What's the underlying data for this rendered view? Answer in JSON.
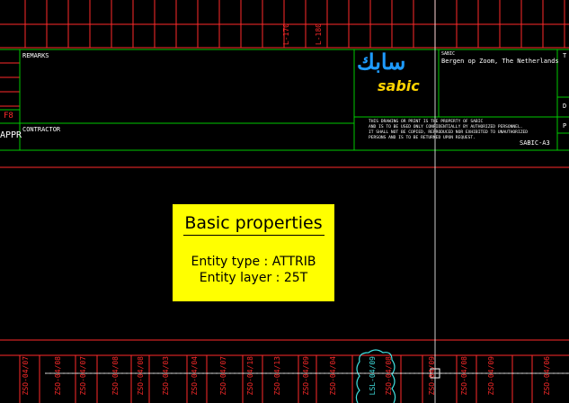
{
  "titleblock": {
    "remarks_label": "REMARKS",
    "contractor_label": "CONTRACTOR",
    "f8_label": "F8",
    "appr_label": "APPR",
    "company_code": "SABIC",
    "company_location": "Bergen op Zoom, The Netherlands",
    "logo_arabic": "سابك",
    "logo_latin": "sabic",
    "disclaimer_lines": [
      "THIS DRAWING OR PRINT IS THE PROPERTY OF SABIC",
      "AND IS TO BE USED ONLY CONFIDENTIALLY BY AUTHORIZED PERSONNEL.",
      "IT SHALL NOT BE COPIED, REPRODUCED NOR EXHIBITED TO UNAUTHORIZED",
      "PERSONS AND IS TO BE RETURNED UPON REQUEST."
    ],
    "sheet_format": "SABIC-A3",
    "right_edge_labels": [
      "T",
      "D",
      "P"
    ]
  },
  "top_vertical_labels": [
    "L-170",
    "L-180"
  ],
  "bottom_vertical_labels": [
    "ZSO-04/07",
    "ZSO-04/08",
    "ZSO-04/07",
    "ZSO-04/08",
    "ZSO-04/08",
    "ZSO-04/03",
    "ZSO-04/04",
    "ZSO-04/07",
    "ZSO-04/18",
    "ZSO-04/13",
    "ZSO-04/09",
    "ZSO-04/04",
    "LSL-04/09",
    "ZSO-04/08",
    "ZSO-04/09",
    "ZSO-04/08",
    "ZSO-04/09",
    "ZSO-04/06"
  ],
  "properties_popup": {
    "title": "Basic properties",
    "entity_type_label": "Entity type",
    "entity_type_value": ": ATTRIB",
    "entity_layer_label": "Entity layer",
    "entity_layer_value": ": 25T"
  },
  "colors": {
    "background": "#000000",
    "grid_red": "#ff2a2a",
    "frame_green": "#00c800",
    "popup_yellow": "#ffff00",
    "cursor_white": "#ffffff",
    "highlight_cyan": "#40e0e0",
    "logo_blue": "#1e9bff",
    "logo_yellow": "#ffd400"
  }
}
